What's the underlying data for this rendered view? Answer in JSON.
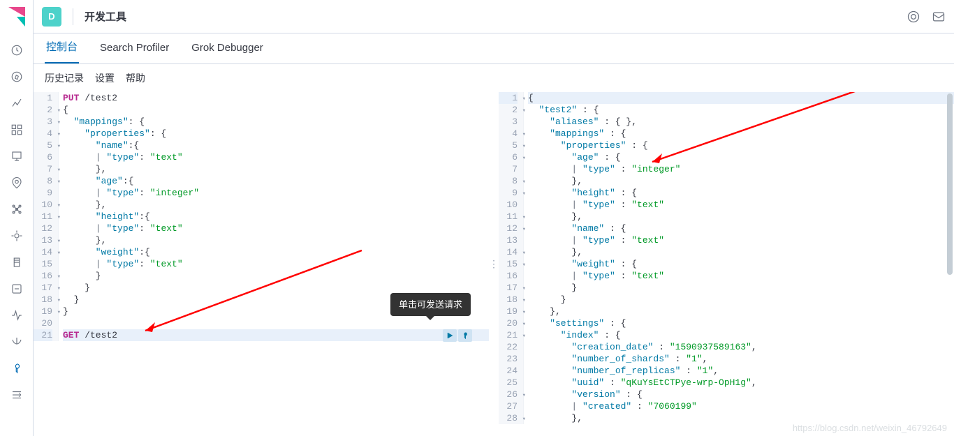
{
  "header": {
    "app_badge_letter": "D",
    "breadcrumb": "开发工具"
  },
  "tabs": [
    {
      "label": "控制台",
      "active": true
    },
    {
      "label": "Search Profiler",
      "active": false
    },
    {
      "label": "Grok Debugger",
      "active": false
    }
  ],
  "toolbar": {
    "history": "历史记录",
    "settings": "设置",
    "help": "帮助"
  },
  "tooltip_text": "单击可发送请求",
  "request_lines": [
    {
      "n": 1,
      "fold": false,
      "method": "PUT",
      "path": " /test2"
    },
    {
      "n": 2,
      "fold": true,
      "text": "{"
    },
    {
      "n": 3,
      "fold": true,
      "key": "  \"mappings\"",
      "colon": ": {"
    },
    {
      "n": 4,
      "fold": true,
      "key": "    \"properties\"",
      "colon": ": {"
    },
    {
      "n": 5,
      "fold": true,
      "key": "      \"name\"",
      "colon": ":{"
    },
    {
      "n": 6,
      "fold": false,
      "pipe": "      | ",
      "key": "\"type\"",
      "colon": ": ",
      "val": "\"text\""
    },
    {
      "n": 7,
      "fold": true,
      "text": "      },"
    },
    {
      "n": 8,
      "fold": true,
      "key": "      \"age\"",
      "colon": ":{"
    },
    {
      "n": 9,
      "fold": false,
      "pipe": "      | ",
      "key": "\"type\"",
      "colon": ": ",
      "val": "\"integer\""
    },
    {
      "n": 10,
      "fold": true,
      "text": "      },"
    },
    {
      "n": 11,
      "fold": true,
      "key": "      \"height\"",
      "colon": ":{"
    },
    {
      "n": 12,
      "fold": false,
      "pipe": "      | ",
      "key": "\"type\"",
      "colon": ": ",
      "val": "\"text\""
    },
    {
      "n": 13,
      "fold": true,
      "text": "      },"
    },
    {
      "n": 14,
      "fold": true,
      "key": "      \"weight\"",
      "colon": ":{"
    },
    {
      "n": 15,
      "fold": false,
      "pipe": "      | ",
      "key": "\"type\"",
      "colon": ": ",
      "val": "\"text\""
    },
    {
      "n": 16,
      "fold": true,
      "text": "      }"
    },
    {
      "n": 17,
      "fold": true,
      "text": "    }"
    },
    {
      "n": 18,
      "fold": true,
      "text": "  }"
    },
    {
      "n": 19,
      "fold": true,
      "text": "}"
    },
    {
      "n": 20,
      "fold": false,
      "text": ""
    },
    {
      "n": 21,
      "fold": false,
      "method": "GET",
      "path": " /test2",
      "active": true
    }
  ],
  "response_lines": [
    {
      "n": 1,
      "fold": true,
      "text": "{",
      "active": true
    },
    {
      "n": 2,
      "fold": true,
      "key": "  \"test2\"",
      "colon": " : {"
    },
    {
      "n": 3,
      "fold": false,
      "key": "    \"aliases\"",
      "colon": " : { },"
    },
    {
      "n": 4,
      "fold": true,
      "key": "    \"mappings\"",
      "colon": " : {"
    },
    {
      "n": 5,
      "fold": true,
      "key": "      \"properties\"",
      "colon": " : {"
    },
    {
      "n": 6,
      "fold": true,
      "key": "        \"age\"",
      "colon": " : {"
    },
    {
      "n": 7,
      "fold": false,
      "pipe": "        | ",
      "key": "\"type\"",
      "colon": " : ",
      "val": "\"integer\""
    },
    {
      "n": 8,
      "fold": true,
      "text": "        },"
    },
    {
      "n": 9,
      "fold": true,
      "key": "        \"height\"",
      "colon": " : {"
    },
    {
      "n": 10,
      "fold": false,
      "pipe": "        | ",
      "key": "\"type\"",
      "colon": " : ",
      "val": "\"text\""
    },
    {
      "n": 11,
      "fold": true,
      "text": "        },"
    },
    {
      "n": 12,
      "fold": true,
      "key": "        \"name\"",
      "colon": " : {"
    },
    {
      "n": 13,
      "fold": false,
      "pipe": "        | ",
      "key": "\"type\"",
      "colon": " : ",
      "val": "\"text\""
    },
    {
      "n": 14,
      "fold": true,
      "text": "        },"
    },
    {
      "n": 15,
      "fold": true,
      "key": "        \"weight\"",
      "colon": " : {"
    },
    {
      "n": 16,
      "fold": false,
      "pipe": "        | ",
      "key": "\"type\"",
      "colon": " : ",
      "val": "\"text\""
    },
    {
      "n": 17,
      "fold": true,
      "text": "        }"
    },
    {
      "n": 18,
      "fold": true,
      "text": "      }"
    },
    {
      "n": 19,
      "fold": true,
      "text": "    },"
    },
    {
      "n": 20,
      "fold": true,
      "key": "    \"settings\"",
      "colon": " : {"
    },
    {
      "n": 21,
      "fold": true,
      "key": "      \"index\"",
      "colon": " : {"
    },
    {
      "n": 22,
      "fold": false,
      "key": "        \"creation_date\"",
      "colon": " : ",
      "val": "\"1590937589163\"",
      "comma": ","
    },
    {
      "n": 23,
      "fold": false,
      "key": "        \"number_of_shards\"",
      "colon": " : ",
      "val": "\"1\"",
      "comma": ","
    },
    {
      "n": 24,
      "fold": false,
      "key": "        \"number_of_replicas\"",
      "colon": " : ",
      "val": "\"1\"",
      "comma": ","
    },
    {
      "n": 25,
      "fold": false,
      "key": "        \"uuid\"",
      "colon": " : ",
      "val": "\"qKuYsEtCTPye-wrp-OpH1g\"",
      "comma": ","
    },
    {
      "n": 26,
      "fold": true,
      "key": "        \"version\"",
      "colon": " : {"
    },
    {
      "n": 27,
      "fold": false,
      "pipe": "        | ",
      "key": "\"created\"",
      "colon": " : ",
      "val": "\"7060199\""
    },
    {
      "n": 28,
      "fold": true,
      "text": "        },"
    }
  ],
  "watermark": "https://blog.csdn.net/weixin_46792649"
}
